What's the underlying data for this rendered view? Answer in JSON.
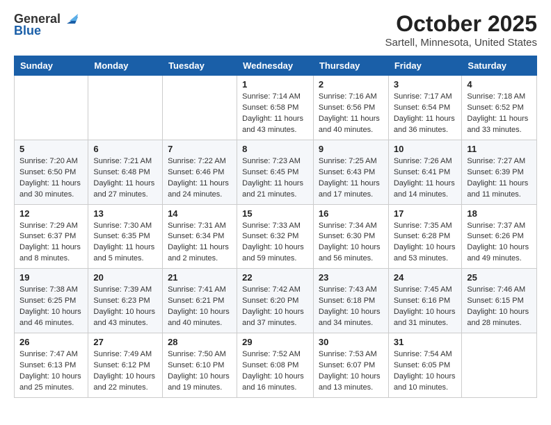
{
  "logo": {
    "line1": "General",
    "line2": "Blue"
  },
  "title": "October 2025",
  "location": "Sartell, Minnesota, United States",
  "weekdays": [
    "Sunday",
    "Monday",
    "Tuesday",
    "Wednesday",
    "Thursday",
    "Friday",
    "Saturday"
  ],
  "weeks": [
    [
      {
        "day": "",
        "info": ""
      },
      {
        "day": "",
        "info": ""
      },
      {
        "day": "",
        "info": ""
      },
      {
        "day": "1",
        "info": "Sunrise: 7:14 AM\nSunset: 6:58 PM\nDaylight: 11 hours and 43 minutes."
      },
      {
        "day": "2",
        "info": "Sunrise: 7:16 AM\nSunset: 6:56 PM\nDaylight: 11 hours and 40 minutes."
      },
      {
        "day": "3",
        "info": "Sunrise: 7:17 AM\nSunset: 6:54 PM\nDaylight: 11 hours and 36 minutes."
      },
      {
        "day": "4",
        "info": "Sunrise: 7:18 AM\nSunset: 6:52 PM\nDaylight: 11 hours and 33 minutes."
      }
    ],
    [
      {
        "day": "5",
        "info": "Sunrise: 7:20 AM\nSunset: 6:50 PM\nDaylight: 11 hours and 30 minutes."
      },
      {
        "day": "6",
        "info": "Sunrise: 7:21 AM\nSunset: 6:48 PM\nDaylight: 11 hours and 27 minutes."
      },
      {
        "day": "7",
        "info": "Sunrise: 7:22 AM\nSunset: 6:46 PM\nDaylight: 11 hours and 24 minutes."
      },
      {
        "day": "8",
        "info": "Sunrise: 7:23 AM\nSunset: 6:45 PM\nDaylight: 11 hours and 21 minutes."
      },
      {
        "day": "9",
        "info": "Sunrise: 7:25 AM\nSunset: 6:43 PM\nDaylight: 11 hours and 17 minutes."
      },
      {
        "day": "10",
        "info": "Sunrise: 7:26 AM\nSunset: 6:41 PM\nDaylight: 11 hours and 14 minutes."
      },
      {
        "day": "11",
        "info": "Sunrise: 7:27 AM\nSunset: 6:39 PM\nDaylight: 11 hours and 11 minutes."
      }
    ],
    [
      {
        "day": "12",
        "info": "Sunrise: 7:29 AM\nSunset: 6:37 PM\nDaylight: 11 hours and 8 minutes."
      },
      {
        "day": "13",
        "info": "Sunrise: 7:30 AM\nSunset: 6:35 PM\nDaylight: 11 hours and 5 minutes."
      },
      {
        "day": "14",
        "info": "Sunrise: 7:31 AM\nSunset: 6:34 PM\nDaylight: 11 hours and 2 minutes."
      },
      {
        "day": "15",
        "info": "Sunrise: 7:33 AM\nSunset: 6:32 PM\nDaylight: 10 hours and 59 minutes."
      },
      {
        "day": "16",
        "info": "Sunrise: 7:34 AM\nSunset: 6:30 PM\nDaylight: 10 hours and 56 minutes."
      },
      {
        "day": "17",
        "info": "Sunrise: 7:35 AM\nSunset: 6:28 PM\nDaylight: 10 hours and 53 minutes."
      },
      {
        "day": "18",
        "info": "Sunrise: 7:37 AM\nSunset: 6:26 PM\nDaylight: 10 hours and 49 minutes."
      }
    ],
    [
      {
        "day": "19",
        "info": "Sunrise: 7:38 AM\nSunset: 6:25 PM\nDaylight: 10 hours and 46 minutes."
      },
      {
        "day": "20",
        "info": "Sunrise: 7:39 AM\nSunset: 6:23 PM\nDaylight: 10 hours and 43 minutes."
      },
      {
        "day": "21",
        "info": "Sunrise: 7:41 AM\nSunset: 6:21 PM\nDaylight: 10 hours and 40 minutes."
      },
      {
        "day": "22",
        "info": "Sunrise: 7:42 AM\nSunset: 6:20 PM\nDaylight: 10 hours and 37 minutes."
      },
      {
        "day": "23",
        "info": "Sunrise: 7:43 AM\nSunset: 6:18 PM\nDaylight: 10 hours and 34 minutes."
      },
      {
        "day": "24",
        "info": "Sunrise: 7:45 AM\nSunset: 6:16 PM\nDaylight: 10 hours and 31 minutes."
      },
      {
        "day": "25",
        "info": "Sunrise: 7:46 AM\nSunset: 6:15 PM\nDaylight: 10 hours and 28 minutes."
      }
    ],
    [
      {
        "day": "26",
        "info": "Sunrise: 7:47 AM\nSunset: 6:13 PM\nDaylight: 10 hours and 25 minutes."
      },
      {
        "day": "27",
        "info": "Sunrise: 7:49 AM\nSunset: 6:12 PM\nDaylight: 10 hours and 22 minutes."
      },
      {
        "day": "28",
        "info": "Sunrise: 7:50 AM\nSunset: 6:10 PM\nDaylight: 10 hours and 19 minutes."
      },
      {
        "day": "29",
        "info": "Sunrise: 7:52 AM\nSunset: 6:08 PM\nDaylight: 10 hours and 16 minutes."
      },
      {
        "day": "30",
        "info": "Sunrise: 7:53 AM\nSunset: 6:07 PM\nDaylight: 10 hours and 13 minutes."
      },
      {
        "day": "31",
        "info": "Sunrise: 7:54 AM\nSunset: 6:05 PM\nDaylight: 10 hours and 10 minutes."
      },
      {
        "day": "",
        "info": ""
      }
    ]
  ]
}
